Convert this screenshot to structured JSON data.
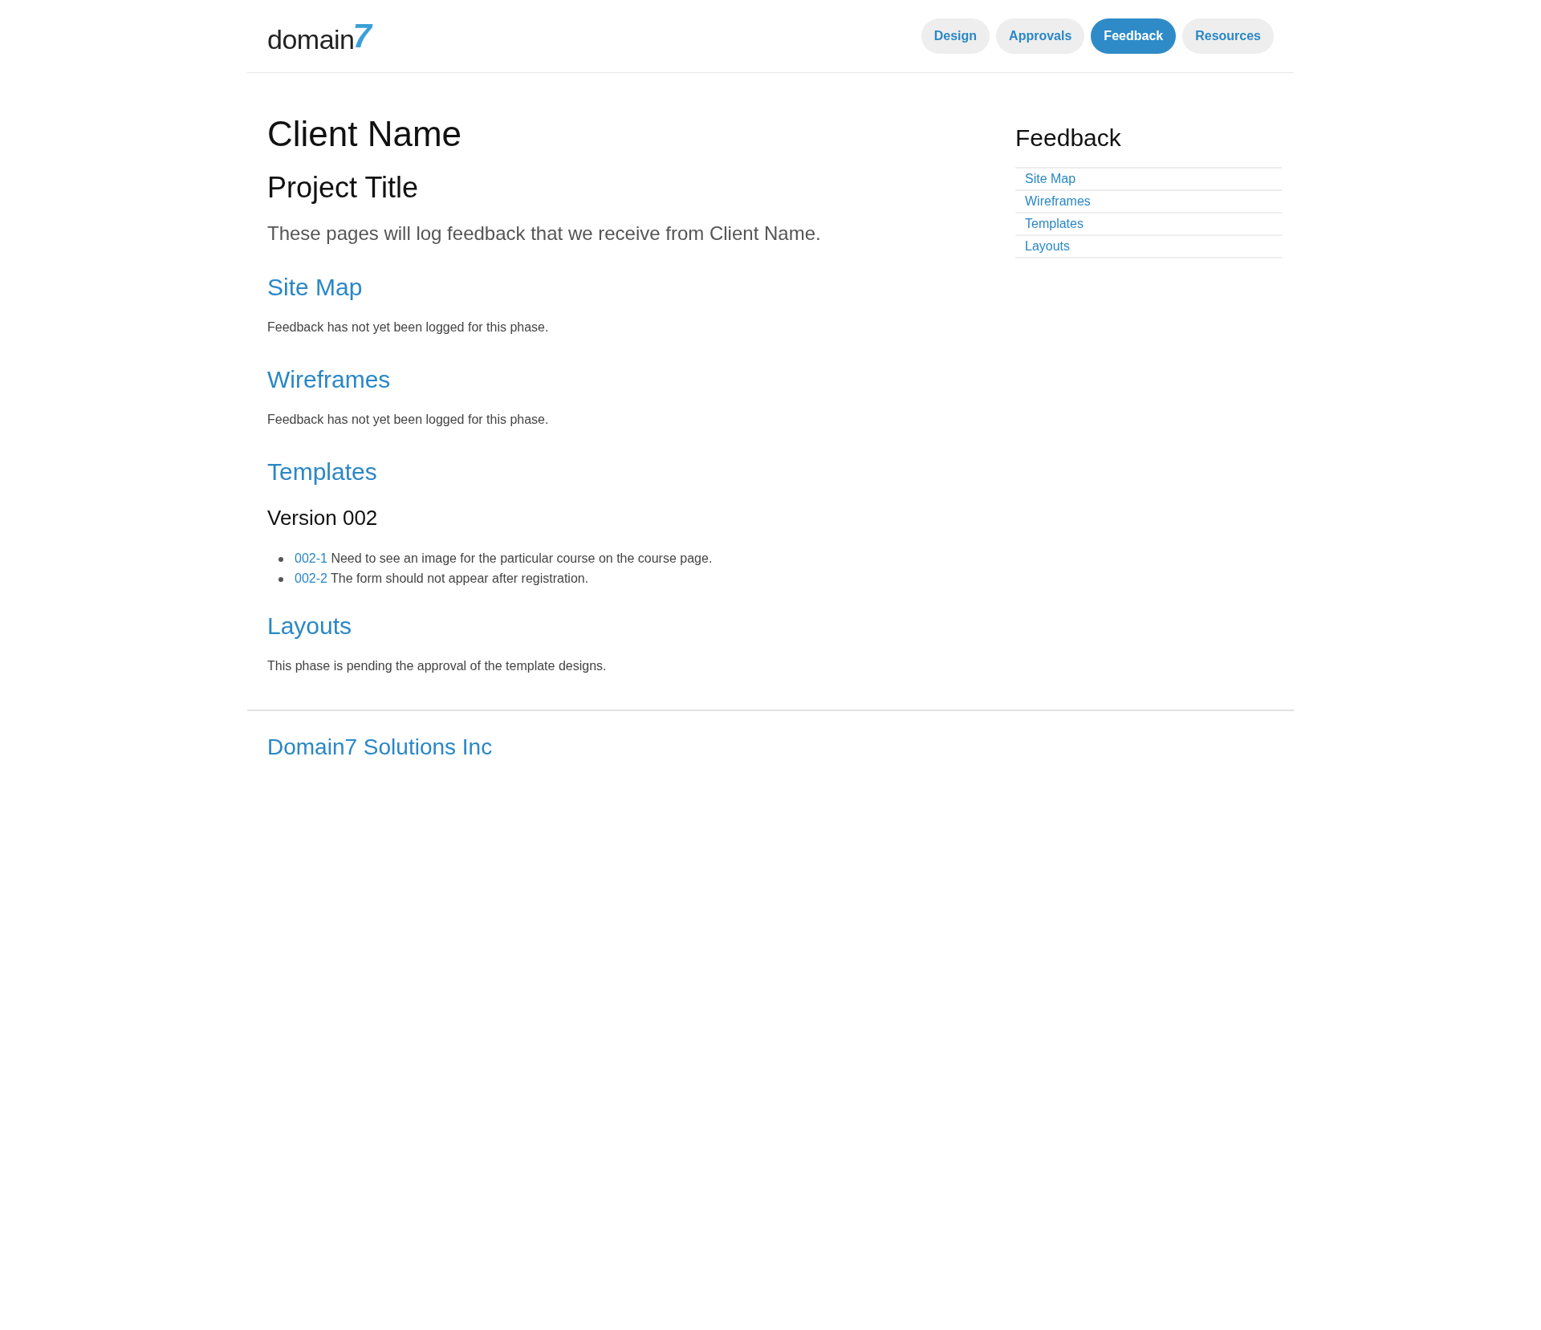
{
  "header": {
    "logo": {
      "word": "domain",
      "digit": "7"
    },
    "nav": [
      {
        "label": "Design",
        "selected": false
      },
      {
        "label": "Approvals",
        "selected": false
      },
      {
        "label": "Feedback",
        "selected": true
      },
      {
        "label": "Resources",
        "selected": false
      }
    ]
  },
  "main": {
    "title": "Client Name",
    "subtitle": "Project Title",
    "lead": "These pages will log feedback that we receive from Client Name.",
    "sections": [
      {
        "title": "Site Map",
        "kind": "note",
        "text": "Feedback has not yet been logged for this phase."
      },
      {
        "title": "Wireframes",
        "kind": "note",
        "text": "Feedback has not yet been logged for this phase."
      },
      {
        "title": "Templates",
        "kind": "versions",
        "versions": [
          {
            "title": "Version 002",
            "items": [
              {
                "id": "002-1",
                "text": "Need to see an image for the particular course on the course page."
              },
              {
                "id": "002-2",
                "text": "The form should not appear after registration."
              }
            ]
          }
        ]
      },
      {
        "title": "Layouts",
        "kind": "note",
        "text": "This phase is pending the approval of the template designs."
      }
    ]
  },
  "sidebar": {
    "title": "Feedback",
    "links": [
      "Site Map",
      "Wireframes",
      "Templates",
      "Layouts"
    ]
  },
  "footer": {
    "company": "Domain7 Solutions Inc"
  }
}
